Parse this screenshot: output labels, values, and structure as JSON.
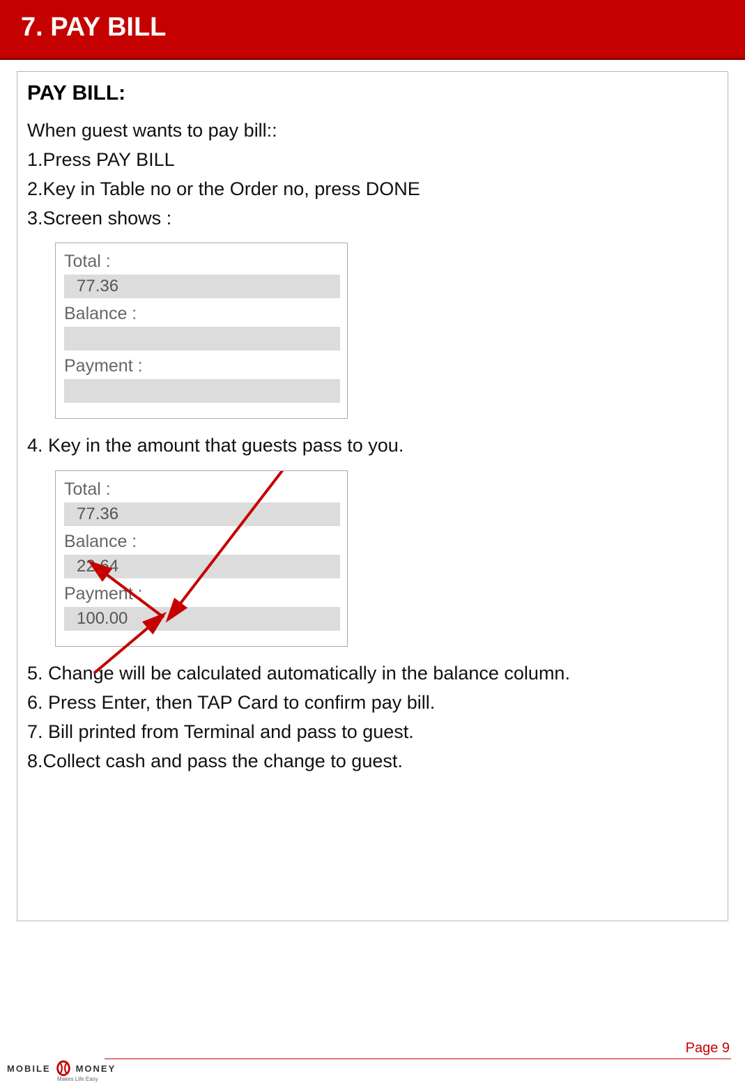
{
  "header": {
    "title": "7. PAY BILL"
  },
  "section": {
    "title": "PAY BILL:"
  },
  "steps": {
    "intro": "When guest wants to pay bill::",
    "s1": "1.Press PAY BILL",
    "s2": "2.Key in Table no or the Order no, press DONE",
    "s3": "3.Screen shows :",
    "s4": "4. Key in the amount that guests pass to you.",
    "s5": "5. Change will be calculated automatically in the balance column.",
    "s6": "6. Press Enter, then TAP Card to confirm pay bill.",
    "s7": "7. Bill printed from Terminal and pass to guest.",
    "s8": "8.Collect cash and pass the change to guest."
  },
  "panel1": {
    "total_label": "Total :",
    "total_value": "77.36",
    "balance_label": "Balance :",
    "balance_value": "",
    "payment_label": "Payment :",
    "payment_value": ""
  },
  "panel2": {
    "total_label": "Total :",
    "total_value": "77.36",
    "balance_label": "Balance :",
    "balance_value": "22.64",
    "payment_label": "Payment :",
    "payment_value": "100.00"
  },
  "footer": {
    "page": "Page 9",
    "brand_left": "MOBILE",
    "brand_right": "MONEY",
    "tagline": "Makes Life Easy"
  }
}
